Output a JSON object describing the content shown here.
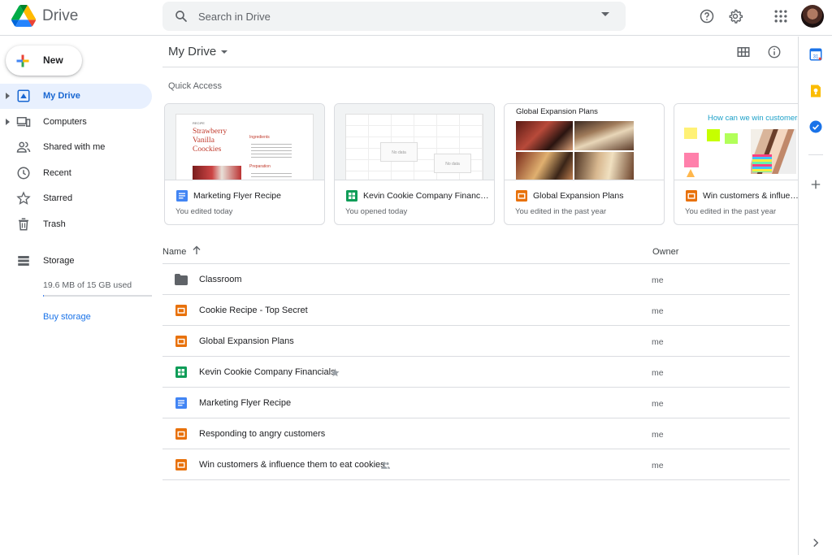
{
  "app": {
    "name": "Drive"
  },
  "search": {
    "placeholder": "Search in Drive"
  },
  "sidebar": {
    "new_label": "New",
    "items": [
      {
        "label": "My Drive",
        "icon": "my-drive-icon",
        "active": true
      },
      {
        "label": "Computers",
        "icon": "computers-icon"
      },
      {
        "label": "Shared with me",
        "icon": "shared-with-me-icon"
      },
      {
        "label": "Recent",
        "icon": "clock-icon"
      },
      {
        "label": "Starred",
        "icon": "star-icon"
      },
      {
        "label": "Trash",
        "icon": "trash-icon"
      },
      {
        "label": "Storage",
        "icon": "storage-icon"
      }
    ],
    "storage_used": "19.6 MB of 15 GB used",
    "storage_fraction": 0.0013,
    "buy_storage": "Buy storage"
  },
  "main": {
    "title": "My Drive",
    "quick_access_label": "Quick Access",
    "quick_access": [
      {
        "name": "Marketing Flyer Recipe",
        "type": "docs",
        "subtitle": "You edited today",
        "thumb": {
          "kicker": "RECIPE",
          "title_lines": [
            "Strawberry",
            "Vanilla",
            "Coockies"
          ],
          "section1": "Ingredients",
          "section2": "Preparation"
        }
      },
      {
        "name": "Kevin Cookie Company Financi...",
        "type": "sheets",
        "subtitle": "You opened today",
        "thumb": {
          "nodata1": "No data",
          "nodata2": "No data"
        }
      },
      {
        "name": "Global Expansion Plans",
        "type": "slides",
        "subtitle": "You edited in the past year",
        "thumb": {
          "heading": "Global Expansion Plans"
        }
      },
      {
        "name": "Win customers & influence them to eat cookies",
        "type": "slides",
        "subtitle": "You edited in the past year",
        "thumb": {
          "heading": "How can we win customers"
        }
      }
    ],
    "list": {
      "col_name": "Name",
      "col_owner": "Owner",
      "files": [
        {
          "name": "Classroom",
          "type": "folder",
          "owner": "me"
        },
        {
          "name": "Cookie Recipe - Top Secret",
          "type": "slides",
          "owner": "me"
        },
        {
          "name": "Global Expansion Plans",
          "type": "slides",
          "owner": "me"
        },
        {
          "name": "Kevin Cookie Company Financials",
          "type": "sheets",
          "owner": "me",
          "starred": true
        },
        {
          "name": "Marketing Flyer Recipe",
          "type": "docs",
          "owner": "me"
        },
        {
          "name": "Responding to angry customers",
          "type": "slides",
          "owner": "me"
        },
        {
          "name": "Win customers & influence them to eat cookies",
          "type": "slides",
          "owner": "me",
          "shared": true
        }
      ]
    }
  },
  "colors": {
    "accent": "#1a73e8",
    "docs": "#4285f4",
    "sheets": "#0f9d58",
    "slides": "#f4b400",
    "slides_orange": "#e8710a"
  }
}
